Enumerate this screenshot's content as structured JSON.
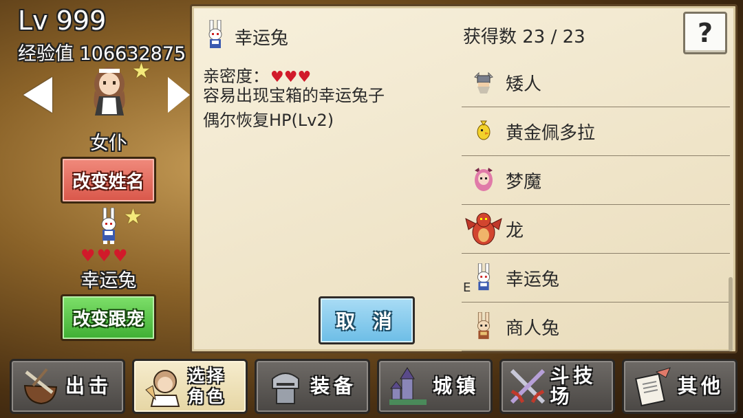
{
  "player": {
    "level": "Lv 999",
    "exp": "经验值 106632875"
  },
  "character": {
    "name": "女仆",
    "rename_label": "改变姓名"
  },
  "pet": {
    "name": "幸运兔",
    "change_label": "改变跟宠",
    "hearts": "♥♥♥"
  },
  "detail": {
    "title": "幸运兔",
    "affinity_label": "亲密度：",
    "affinity_hearts": "♥♥♥",
    "description": "容易出现宝箱的幸运兔子\n偶尔恢复HP(Lv2)",
    "cancel_label": "取 消"
  },
  "collection": {
    "count": "获得数 23 / 23",
    "help_label": "?",
    "items": [
      {
        "label": "矮人",
        "icon": "dwarf-icon",
        "tag": ""
      },
      {
        "label": "黄金佩多拉",
        "icon": "golden-bird-icon",
        "tag": ""
      },
      {
        "label": "梦魔",
        "icon": "succubus-icon",
        "tag": ""
      },
      {
        "label": "龙",
        "icon": "dragon-icon",
        "tag": ""
      },
      {
        "label": "幸运兔",
        "icon": "lucky-rabbit-icon",
        "tag": "E"
      },
      {
        "label": "商人兔",
        "icon": "merchant-rabbit-icon",
        "tag": ""
      }
    ]
  },
  "nav": {
    "items": [
      {
        "label": "出击",
        "icon": "sortie-icon"
      },
      {
        "label": "选择\n角色",
        "icon": "select-character-icon"
      },
      {
        "label": "装备",
        "icon": "equipment-icon"
      },
      {
        "label": "城镇",
        "icon": "town-icon"
      },
      {
        "label": "斗技场",
        "icon": "arena-icon"
      },
      {
        "label": "其他",
        "icon": "other-icon"
      }
    ]
  },
  "colors": {
    "heart": "#d11a2a",
    "rename_button": "#e0695b",
    "pet_button": "#52c242",
    "cancel_button": "#86caec",
    "panel": "#f3ead2"
  }
}
